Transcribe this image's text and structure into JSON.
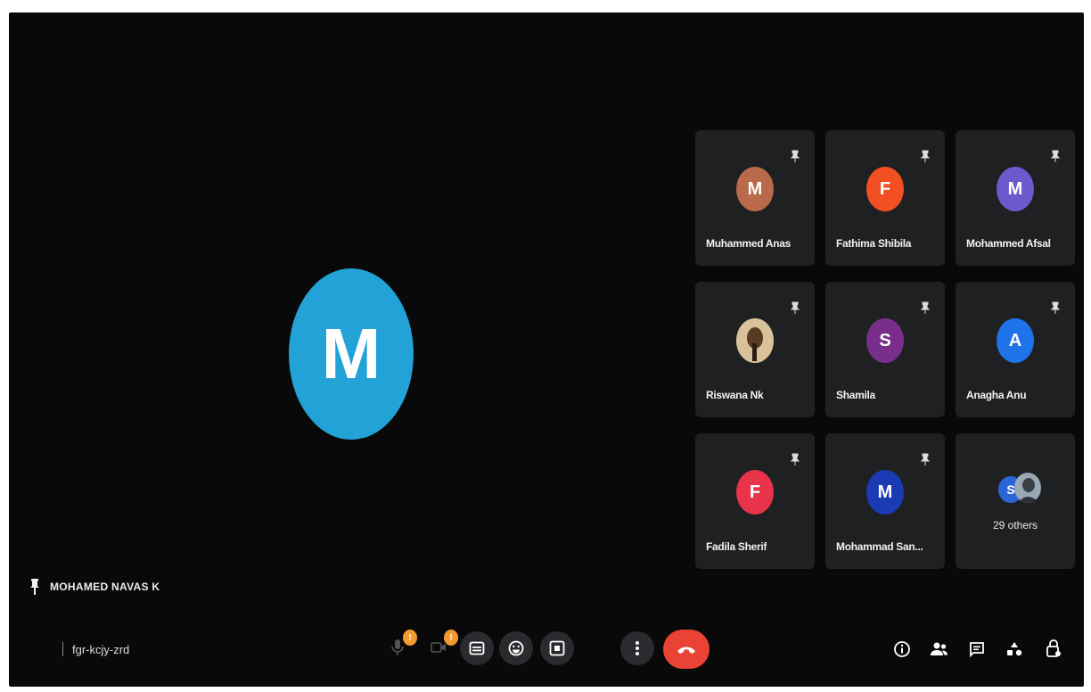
{
  "colors": {
    "main_avatar": "#22a2d6",
    "leave": "#ea4335",
    "badge": "#f29a2e"
  },
  "main": {
    "avatar_letter": "M",
    "presenter_name": "MOHAMED NAVAS K"
  },
  "participants": [
    {
      "name": "Muhammed Anas",
      "initial": "M",
      "color": "#b86a4a"
    },
    {
      "name": "Fathima Shibila",
      "initial": "F",
      "color": "#f25022"
    },
    {
      "name": "Mohammed Afsal",
      "initial": "M",
      "color": "#6a5acd"
    },
    {
      "name": "Riswana Nk",
      "initial": "",
      "color": "#c7b08a"
    },
    {
      "name": "Shamila",
      "initial": "S",
      "color": "#7a2e8c"
    },
    {
      "name": "Anagha Anu",
      "initial": "A",
      "color": "#1e73e8"
    },
    {
      "name": "Fadila Sherif",
      "initial": "F",
      "color": "#e8334a"
    },
    {
      "name": "Mohammad San...",
      "initial": "M",
      "color": "#1a3bb3"
    }
  ],
  "others": {
    "label": "29 others",
    "initial": "S",
    "color": "#2a66d8"
  },
  "meeting": {
    "code": "fgr-kcjy-zrd"
  },
  "toolbar": {
    "mic_badge": "!",
    "camera_badge": "!"
  },
  "icons": {
    "mic": "mic-icon",
    "camera": "camera-icon",
    "captions": "captions-icon",
    "emoji": "emoji-icon",
    "present": "present-icon",
    "more": "more-vert-icon",
    "leave": "call-end-icon",
    "info": "info-icon",
    "people": "people-icon",
    "chat": "chat-icon",
    "activities": "activities-icon",
    "host_controls": "host-controls-icon",
    "pin": "pin-icon"
  }
}
